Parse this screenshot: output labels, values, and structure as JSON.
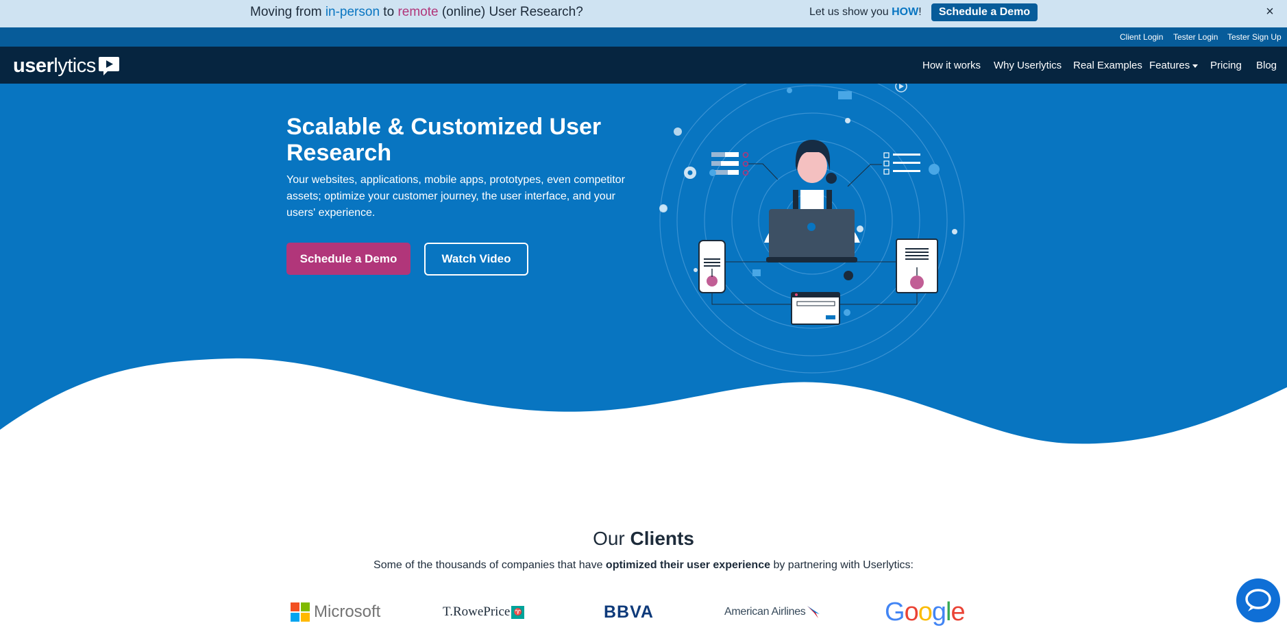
{
  "announcement": {
    "text_prefix": "Moving from ",
    "in_person": "in-person",
    "text_mid": " to ",
    "remote": "remote",
    "text_suffix": " (online) User Research?",
    "let_us": "Let us show you ",
    "how": "HOW",
    "exclaim": "!",
    "cta": "Schedule a Demo",
    "close_icon": "×"
  },
  "utility_links": [
    "Client Login",
    "Tester Login",
    "Tester Sign Up"
  ],
  "nav": {
    "logo_prefix": "user",
    "logo_suffix": "lytics",
    "items": [
      "How it works",
      "Why Userlytics",
      "Real Examples",
      "Features",
      "Pricing",
      "Blog"
    ]
  },
  "hero": {
    "title": "Scalable & Customized User Research",
    "subtitle": "Your websites, applications, mobile apps, prototypes, even competitor assets; optimize your customer journey, the user interface, and your users' experience.",
    "primary_cta": "Schedule a Demo",
    "secondary_cta": "Watch Video"
  },
  "clients": {
    "title_prefix": "Our ",
    "title_bold": "Clients",
    "sub_prefix": "Some of the thousands of companies that have ",
    "sub_bold": "optimized their user experience",
    "sub_suffix": " by partnering with Userlytics:",
    "logos": {
      "microsoft": "Microsoft",
      "trowe": "T.RowePrice",
      "bbva": "BBVA",
      "american": "American Airlines",
      "google": [
        "G",
        "o",
        "o",
        "g",
        "l",
        "e"
      ]
    }
  },
  "colors": {
    "brand_blue": "#0875c1",
    "nav_dark": "#062540",
    "accent_pink": "#b1367a",
    "announce_bg": "#cfe3f2"
  }
}
